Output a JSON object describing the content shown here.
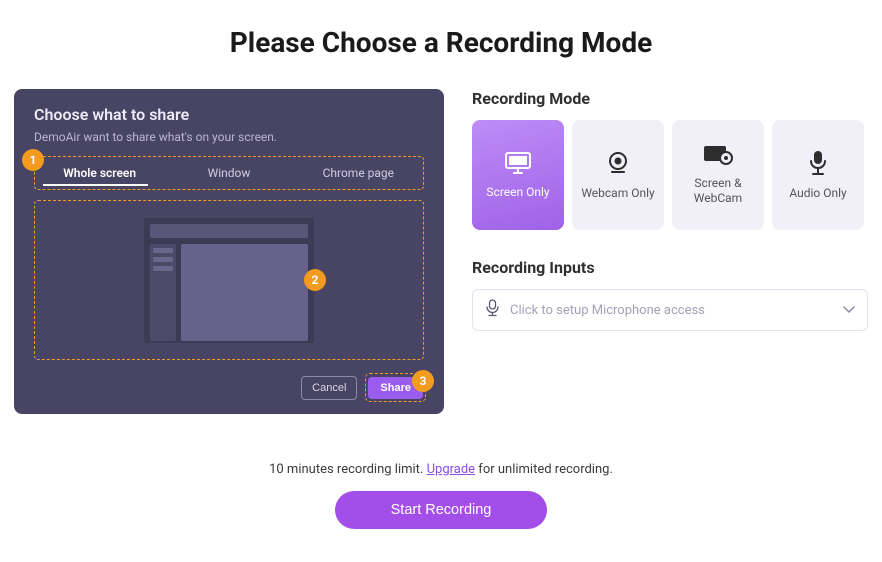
{
  "page_title": "Please Choose a Recording Mode",
  "share_panel": {
    "title": "Choose what to share",
    "subtitle": "DemoAir want to share what's on your screen.",
    "tabs": {
      "whole_screen": "Whole screen",
      "window": "Window",
      "chrome_page": "Chrome page"
    },
    "markers": {
      "m1": "1",
      "m2": "2",
      "m3": "3"
    },
    "cancel_label": "Cancel",
    "share_label": "Share"
  },
  "recording_mode": {
    "heading": "Recording Mode",
    "options": {
      "screen_only": "Screen Only",
      "webcam_only": "Webcam Only",
      "screen_webcam": "Screen & WebCam",
      "audio_only": "Audio Only"
    }
  },
  "recording_inputs": {
    "heading": "Recording Inputs",
    "placeholder": "Click to setup Microphone access"
  },
  "footer": {
    "limit_prefix": "10 minutes recording limit. ",
    "upgrade_label": "Upgrade",
    "limit_suffix": " for unlimited recording.",
    "start_label": "Start Recording"
  }
}
